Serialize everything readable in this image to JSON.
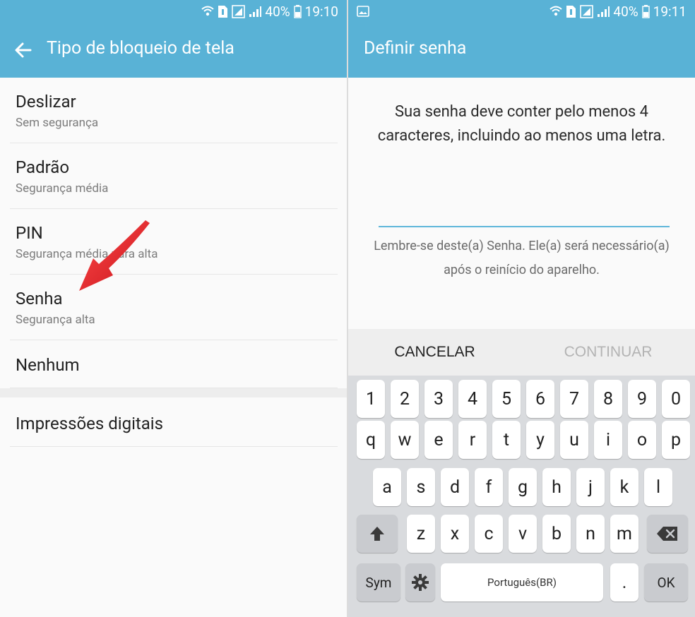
{
  "status_left": {
    "battery": "40%",
    "time": "19:10"
  },
  "status_right": {
    "battery": "40%",
    "time": "19:11"
  },
  "left_appbar": {
    "title": "Tipo de bloqueio de tela"
  },
  "right_appbar": {
    "title": "Definir senha"
  },
  "lock_types": [
    {
      "title": "Deslizar",
      "subtitle": "Sem segurança"
    },
    {
      "title": "Padrão",
      "subtitle": "Segurança média"
    },
    {
      "title": "PIN",
      "subtitle": "Segurança média para alta"
    },
    {
      "title": "Senha",
      "subtitle": "Segurança alta"
    },
    {
      "title": "Nenhum"
    }
  ],
  "extra_items": [
    {
      "title": "Impressões digitais"
    }
  ],
  "dialog": {
    "instruction": "Sua senha deve conter pelo menos 4 caracteres, incluindo ao menos uma letra.",
    "password_value": "",
    "hint": "Lembre-se deste(a) Senha. Ele(a) será necessário(a) após o reinício do aparelho.",
    "cancel_label": "CANCELAR",
    "continue_label": "CONTINUAR"
  },
  "keyboard": {
    "row_numbers": [
      "1",
      "2",
      "3",
      "4",
      "5",
      "6",
      "7",
      "8",
      "9",
      "0"
    ],
    "row_top": [
      "q",
      "w",
      "e",
      "r",
      "t",
      "y",
      "u",
      "i",
      "o",
      "p"
    ],
    "row_middle": [
      "a",
      "s",
      "d",
      "f",
      "g",
      "h",
      "j",
      "k",
      "l"
    ],
    "row_bottom": [
      "z",
      "x",
      "c",
      "v",
      "b",
      "n",
      "m"
    ],
    "sym_label": "Sym",
    "space_label": "Português(BR)",
    "period_label": ".",
    "ok_label": "OK"
  },
  "icons": {
    "back": "arrow-left-icon",
    "gallery": "gallery-icon",
    "shift": "shift-icon",
    "backspace": "backspace-icon",
    "settings": "gear-icon",
    "wifi": "wifi-icon",
    "sim": "sim-icon",
    "signal": "signal-icon",
    "battery": "battery-icon"
  },
  "colors": {
    "appbar": "#59b2d6",
    "accent": "#5fb6da",
    "annotation_arrow": "#e8232a"
  }
}
